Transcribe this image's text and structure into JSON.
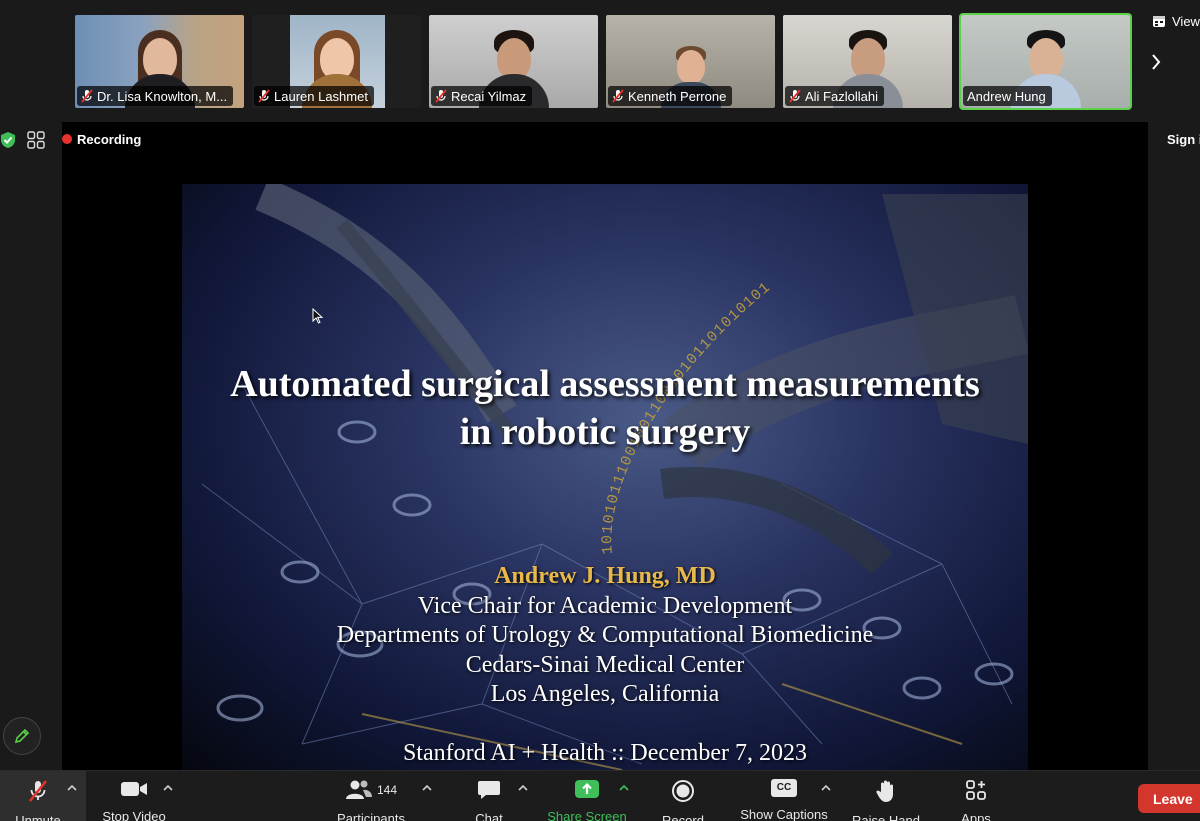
{
  "participants_strip": {
    "tiles": [
      {
        "name": "Dr. Lisa Knowlton, M...",
        "muted": true,
        "active": false
      },
      {
        "name": "Lauren Lashmet",
        "muted": true,
        "active": false
      },
      {
        "name": "Recai Yilmaz",
        "muted": true,
        "active": false
      },
      {
        "name": "Kenneth Perrone",
        "muted": true,
        "active": false
      },
      {
        "name": "Ali Fazlollahi",
        "muted": true,
        "active": false
      },
      {
        "name": "Andrew Hung",
        "muted": false,
        "active": true
      }
    ],
    "view_label": "View"
  },
  "meeting": {
    "recording_label": "Recording",
    "sign_in_label": "Sign i"
  },
  "slide": {
    "title_line1": "Automated surgical assessment measurements",
    "title_line2": "in robotic surgery",
    "author": "Andrew J. Hung, MD",
    "role": "Vice Chair for Academic Development",
    "departments": "Departments of Urology & Computational Biomedicine",
    "institution": "Cedars-Sinai Medical Center",
    "location": "Los Angeles, California",
    "event": "Stanford AI + Health :: December 7, 2023",
    "binary_text": "10101011100100110010101101010101"
  },
  "toolbar": {
    "unmute": "Unmute",
    "stop_video": "Stop Video",
    "participants": "Participants",
    "participants_count": "144",
    "chat": "Chat",
    "share_screen": "Share Screen",
    "record": "Record",
    "show_captions": "Show Captions",
    "captions_icon_text": "CC",
    "raise_hand": "Raise Hand",
    "apps": "Apps",
    "leave": "Leave"
  },
  "colors": {
    "active_border": "#5bd14a",
    "share_green": "#3fbf5a",
    "leave_red": "#d3362c",
    "recording_red": "#e8322e",
    "author_gold": "#e9b84a",
    "mute_red": "#e8322e"
  }
}
